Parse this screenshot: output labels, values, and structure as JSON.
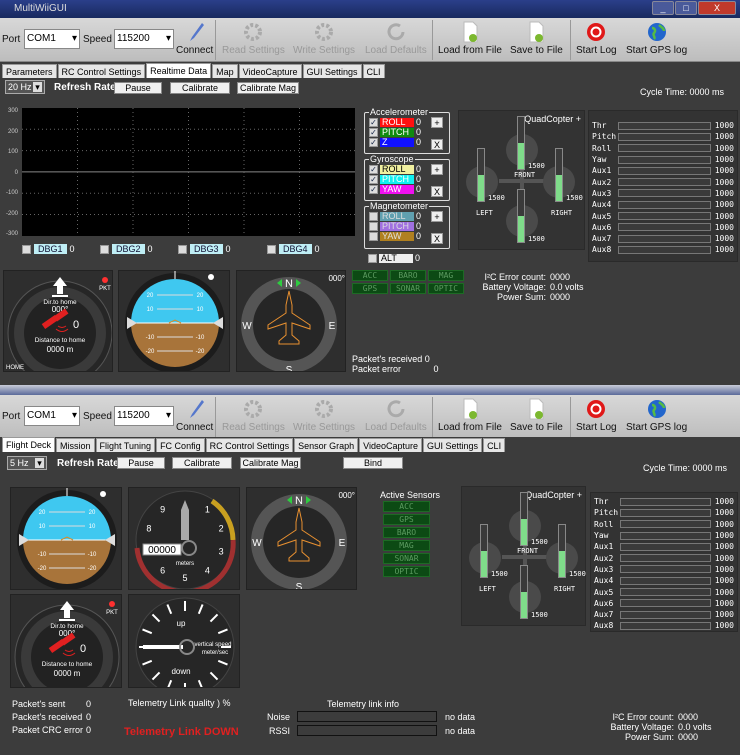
{
  "window": {
    "title": "MultiWiiGUI",
    "minimize": "_",
    "maximize": "□",
    "close": "X"
  },
  "colors": {
    "background": "#3c3c3c",
    "graph": "#000000",
    "accent_green": "#7fdc8a",
    "sky": "#3fc8f0",
    "ground": "#a8743a",
    "link_down": "#e02020"
  },
  "top": {
    "toolbar": {
      "port_label": "Port",
      "port": "COM1",
      "speed_label": "Speed",
      "speed": "115200",
      "connect": "Connect",
      "read": "Read Settings",
      "write": "Write Settings",
      "defaults": "Load Defaults",
      "load": "Load from File",
      "save": "Save to File",
      "log": "Start Log",
      "gpslog": "Start GPS log"
    },
    "tabs": [
      "Parameters",
      "RC Control Settings",
      "Realtime Data",
      "Map",
      "VideoCapture",
      "GUI Settings",
      "CLI"
    ],
    "active_tab": "Realtime Data",
    "refresh": "20 Hz",
    "refresh_label": "Refresh Rate",
    "pause": "Pause",
    "calibrate": "Calibrate",
    "calibrate_mag": "Calibrate Mag",
    "cycle_time": "Cycle Time:  0000 ms",
    "graph_axis": [
      "300",
      "200",
      "100",
      "0",
      "-100",
      "-200",
      "-300"
    ],
    "debug": [
      {
        "label": "DBG1",
        "value": "0"
      },
      {
        "label": "DBG2",
        "value": "0"
      },
      {
        "label": "DBG3",
        "value": "0"
      },
      {
        "label": "DBG4",
        "value": "0"
      }
    ],
    "accelerometer": {
      "title": "Accelerometer",
      "rows": [
        {
          "label": "ROLL",
          "value": "0",
          "color": "#ff1010",
          "checked": true
        },
        {
          "label": "PITCH",
          "value": "0",
          "color": "#108a10",
          "checked": true
        },
        {
          "label": "Z",
          "value": "0",
          "color": "#1010ff",
          "checked": true
        }
      ]
    },
    "gyroscope": {
      "title": "Gyroscope",
      "rows": [
        {
          "label": "ROLL",
          "value": "0",
          "color": "#f0f0a0",
          "checked": true
        },
        {
          "label": "PITCH",
          "value": "0",
          "color": "#10f0f0",
          "checked": true
        },
        {
          "label": "YAW",
          "value": "0",
          "color": "#f010f0",
          "checked": true
        }
      ]
    },
    "magnetometer": {
      "title": "Magnetometer",
      "rows": [
        {
          "label": "ROLL",
          "value": "0",
          "color": "#60a0b0",
          "checked": false
        },
        {
          "label": "PITCH",
          "value": "0",
          "color": "#a070e0",
          "checked": false
        },
        {
          "label": "YAW",
          "value": "0",
          "color": "#b08020",
          "checked": false
        }
      ]
    },
    "alt": {
      "label": "ALT",
      "value": "0"
    },
    "plus": "+",
    "x": "X",
    "sensors": [
      "ACC",
      "BARO",
      "MAG",
      "GPS",
      "SONAR",
      "OPTIC"
    ],
    "status": {
      "i2c_label": "I²C Error count:",
      "i2c": "0000",
      "batt_label": "Battery Voltage:",
      "batt": "0.0 volts",
      "power_label": "Power Sum:",
      "power": "0000"
    },
    "packets": {
      "received_label": "Packet's received",
      "received": "0",
      "error_label": "Packet error",
      "error": "0"
    }
  },
  "quad": {
    "title": "QuadCopter +",
    "front": "FRONT",
    "left": "LEFT",
    "right": "RIGHT",
    "rear": "REAR",
    "motors": [
      1500,
      1500,
      1500,
      1500
    ],
    "motor_labels": [
      "1500",
      "1500",
      "1500",
      "1500"
    ],
    "motor_fill_fraction": 0.5
  },
  "rc": {
    "channels": [
      {
        "name": "Thr",
        "value": "1000"
      },
      {
        "name": "Pitch",
        "value": "1000"
      },
      {
        "name": "Roll",
        "value": "1000"
      },
      {
        "name": "Yaw",
        "value": "1000"
      },
      {
        "name": "Aux1",
        "value": "1000"
      },
      {
        "name": "Aux2",
        "value": "1000"
      },
      {
        "name": "Aux3",
        "value": "1000"
      },
      {
        "name": "Aux4",
        "value": "1000"
      },
      {
        "name": "Aux5",
        "value": "1000"
      },
      {
        "name": "Aux6",
        "value": "1000"
      },
      {
        "name": "Aux7",
        "value": "1000"
      },
      {
        "name": "Aux8",
        "value": "1000"
      }
    ]
  },
  "instruments": {
    "dir_home": "Dir.to home",
    "dir_value": "000°",
    "dist_home": "Distance to home",
    "dist_value": "0000 m",
    "sats": "0",
    "pkt": "PKT",
    "home": "HOME",
    "heading": "000°",
    "N": "N",
    "E": "E",
    "S": "S",
    "W": "W",
    "pitch": [
      "20",
      "10",
      "-10",
      "-20"
    ],
    "meters": "meters",
    "altitude": "00000",
    "vs_label": "vertical speed",
    "vs_unit": "meter/sec",
    "up": "up",
    "down": "down"
  },
  "bottom": {
    "toolbar": {
      "port_label": "Port",
      "port": "COM1",
      "speed_label": "Speed",
      "speed": "115200",
      "connect": "Connect",
      "read": "Read Settings",
      "write": "Write Settings",
      "defaults": "Load Defaults",
      "load": "Load from File",
      "save": "Save to File",
      "log": "Start Log",
      "gpslog": "Start GPS log"
    },
    "tabs": [
      "Flight Deck",
      "Mission",
      "Flight Tuning",
      "FC Config",
      "RC Control Settings",
      "Sensor Graph",
      "VideoCapture",
      "GUI Settings",
      "CLI"
    ],
    "active_tab": "Flight Deck",
    "refresh": "5 Hz",
    "refresh_label": "Refresh Rate",
    "pause": "Pause",
    "calibrate": "Calibrate",
    "calibrate_mag": "Calibrate Mag",
    "bind": "Bind",
    "cycle_time": "Cycle Time:  0000 ms",
    "active_sensors_title": "Active Sensors",
    "sensors": [
      "ACC",
      "GPS",
      "BARO",
      "MAG",
      "SONAR",
      "OPTIC"
    ],
    "packets": {
      "sent_label": "Packet's sent",
      "sent": "0",
      "received_label": "Packet's received",
      "received": "0",
      "crc_label": "Packet CRC error",
      "crc": "0"
    },
    "telemetry": {
      "quality": "Telemetry Link quality ) %",
      "status": "Telemetry Link DOWN",
      "info_title": "Telemetry link info",
      "noise_label": "Noise",
      "noise": "no data",
      "rssi_label": "RSSI",
      "rssi": "no data"
    },
    "status": {
      "i2c_label": "I²C Error count:",
      "i2c": "0000",
      "batt_label": "Battery Voltage:",
      "batt": "0.0 volts",
      "power_label": "Power Sum:",
      "power": "0000"
    }
  }
}
